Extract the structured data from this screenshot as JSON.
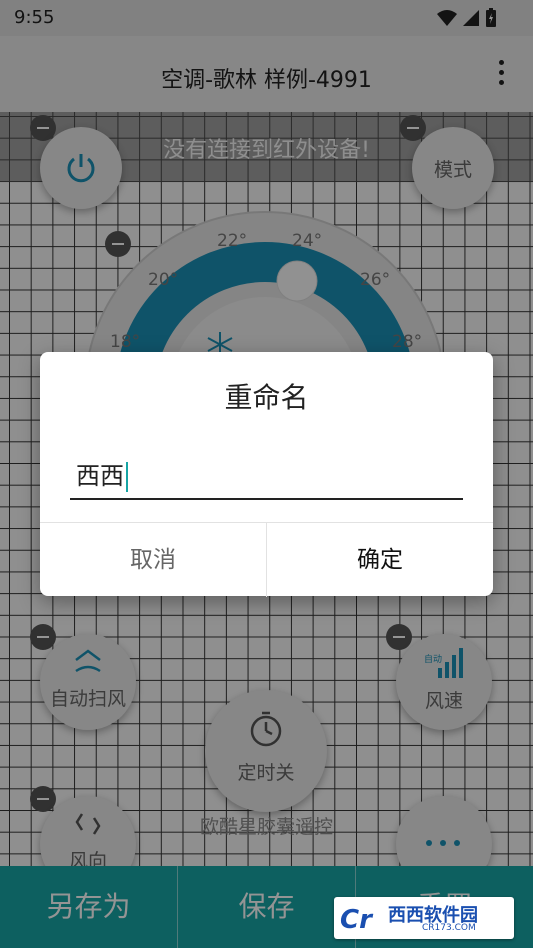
{
  "status_bar": {
    "time": "9:55"
  },
  "app_bar": {
    "title": "空调-歌林 样例-4991"
  },
  "banner": {
    "text": "没有连接到红外设备!"
  },
  "remote": {
    "mode_label": "模式",
    "dial": {
      "ticks": [
        "18°",
        "20°",
        "22°",
        "24°",
        "26°",
        "28°"
      ]
    },
    "swing_label": "自动扫风",
    "speed_label": "风速",
    "timer_label": "定时关",
    "direction_label": "风向",
    "footer_text": "欧酷星胶囊遥控",
    "speed_badge": "自动"
  },
  "bottom_bar": {
    "save_as": "另存为",
    "save": "保存",
    "reset": "重置"
  },
  "dialog": {
    "title": "重命名",
    "input_value": "西西",
    "cancel": "取消",
    "confirm": "确定"
  },
  "watermark": {
    "brand": "西西软件园",
    "url": "CR173.COM",
    "mark": "Cr"
  },
  "colors": {
    "accent": "#17a5a5",
    "dial_blue": "#1a8fb5"
  }
}
